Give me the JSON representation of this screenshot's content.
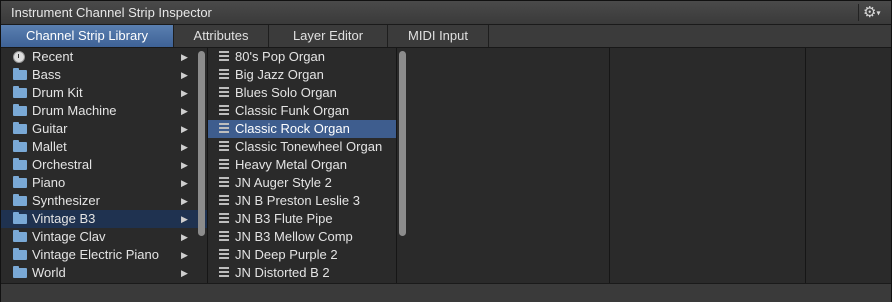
{
  "window": {
    "title": "Instrument Channel Strip Inspector",
    "action_icon": "gear-icon"
  },
  "tabs": [
    {
      "label": "Channel Strip Library",
      "active": true
    },
    {
      "label": "Attributes",
      "active": false
    },
    {
      "label": "Layer Editor",
      "active": false
    },
    {
      "label": "MIDI Input",
      "active": false
    }
  ],
  "categories": [
    {
      "label": "Recent",
      "icon": "clock-icon"
    },
    {
      "label": "Bass",
      "icon": "folder-icon"
    },
    {
      "label": "Drum Kit",
      "icon": "folder-icon"
    },
    {
      "label": "Drum Machine",
      "icon": "folder-icon"
    },
    {
      "label": "Guitar",
      "icon": "folder-icon"
    },
    {
      "label": "Mallet",
      "icon": "folder-icon"
    },
    {
      "label": "Orchestral",
      "icon": "folder-icon"
    },
    {
      "label": "Piano",
      "icon": "folder-icon"
    },
    {
      "label": "Synthesizer",
      "icon": "folder-icon"
    },
    {
      "label": "Vintage B3",
      "icon": "folder-icon",
      "selected": true
    },
    {
      "label": "Vintage Clav",
      "icon": "folder-icon"
    },
    {
      "label": "Vintage Electric Piano",
      "icon": "folder-icon"
    },
    {
      "label": "World",
      "icon": "folder-icon"
    }
  ],
  "presets": [
    {
      "label": "80's Pop Organ"
    },
    {
      "label": "Big Jazz Organ"
    },
    {
      "label": "Blues Solo Organ"
    },
    {
      "label": "Classic Funk Organ"
    },
    {
      "label": "Classic Rock Organ",
      "selected": true
    },
    {
      "label": "Classic Tonewheel Organ"
    },
    {
      "label": "Heavy Metal Organ"
    },
    {
      "label": "JN Auger Style 2"
    },
    {
      "label": "JN B Preston Leslie 3"
    },
    {
      "label": "JN B3 Flute Pipe"
    },
    {
      "label": "JN B3 Mellow Comp"
    },
    {
      "label": "JN Deep Purple 2"
    },
    {
      "label": "JN Distorted B 2"
    }
  ],
  "colors": {
    "selection_active": "#3e5d8e",
    "selection_inactive": "#1f3250",
    "tab_active": "#4a70a6",
    "folder": "#7aa9d6"
  }
}
